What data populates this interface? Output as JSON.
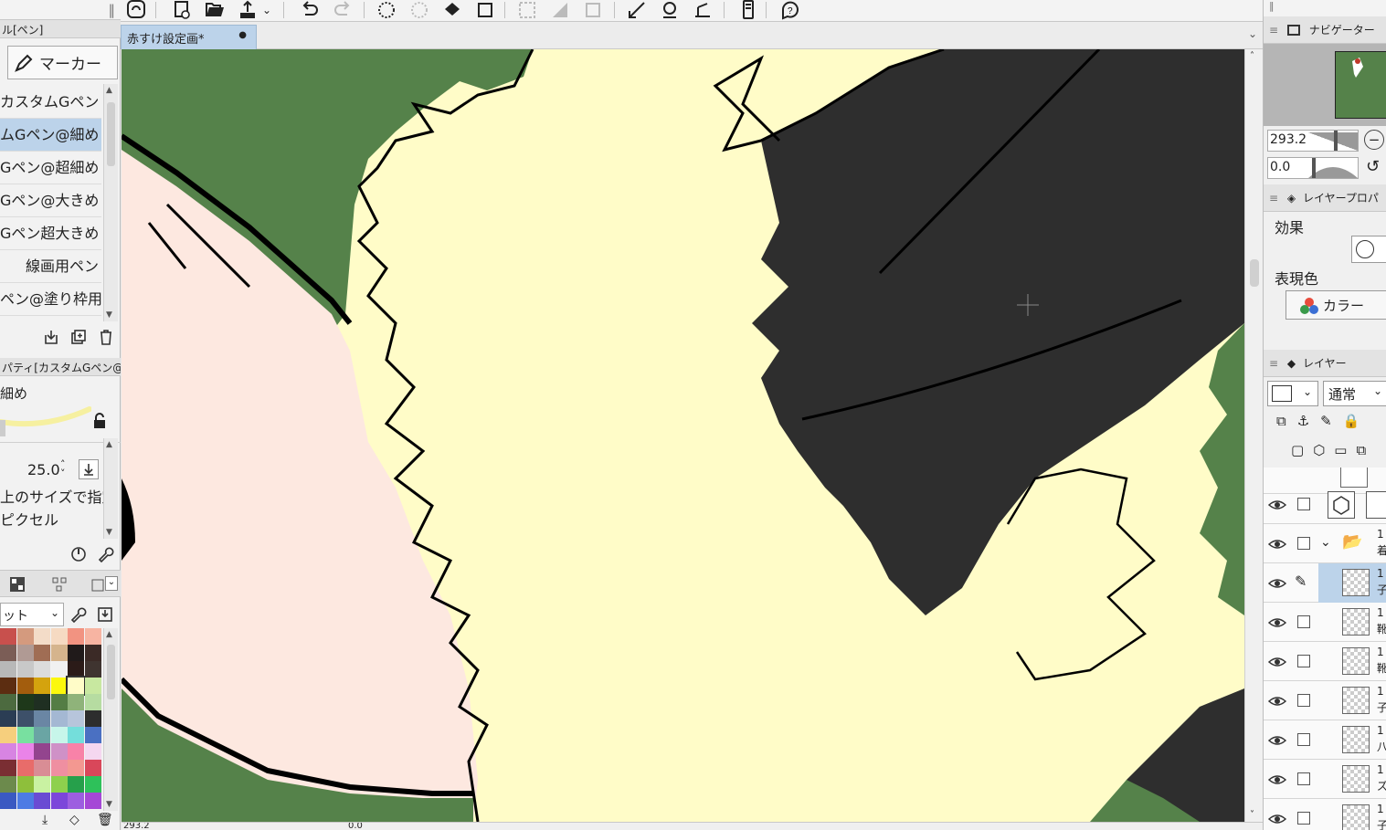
{
  "document_tab": {
    "title": "赤すけ設定画*",
    "modified_dot": "●"
  },
  "left_panel": {
    "panel_title": "ル[ペン]",
    "marker_tab_label": "マーカー",
    "brushes": [
      {
        "label": "カスタムGペン",
        "selected": false
      },
      {
        "label": "ムGペン@細め",
        "selected": true
      },
      {
        "label": "Gペン@超細め",
        "selected": false
      },
      {
        "label": "Gペン@大きめ",
        "selected": false
      },
      {
        "label": "Gペン超大きめ",
        "selected": false
      },
      {
        "label": "線画用ペン",
        "selected": false
      },
      {
        "label": "ペン@塗り枠用",
        "selected": false
      }
    ],
    "property_title": "パティ[カスタムGペン@",
    "property_brush_name": "細め",
    "brush_size_value": "25.0",
    "size_mode_line1": "上のサイズで指定",
    "size_mode_line2": "ピクセル",
    "palette_set_label": "ット"
  },
  "palette_colors": [
    [
      "#c8504d",
      "#d49a7e",
      "#f3dcc8",
      "#f6dac2",
      "#f29381",
      "#f7b4a2"
    ],
    [
      "#7b5d56",
      "#b09a94",
      "#a06d54",
      "#d5b48d",
      "#201a1a",
      "#3b2a26"
    ],
    [
      "#b8b8b8",
      "#c8c8c8",
      "#dcdcdc",
      "#f1f1f1",
      "#2b1b18",
      "#3f3430"
    ],
    [
      "#5c2d11",
      "#a35d0d",
      "#d4a30e",
      "#fcf80c",
      "#fffcc8",
      "#c8e8a0"
    ],
    [
      "#4c6a3f",
      "#1e381a",
      "#1f2f22",
      "#547d45",
      "#8fb37a",
      "#b6dca1"
    ],
    [
      "#2b3d54",
      "#3d5069",
      "#6a86a4",
      "#a4b8d3",
      "#b7c5db",
      "#2d2d2d"
    ],
    [
      "#f6cf7d",
      "#78e0a0",
      "#6aa5a4",
      "#c7f6ea",
      "#74dedb",
      "#4a70c2"
    ],
    [
      "#d784e2",
      "#ea83e8",
      "#93448e",
      "#cf91c7",
      "#f882a8",
      "#f5d7f0"
    ],
    [
      "#7a2e33",
      "#e86c6a",
      "#d98d95",
      "#ef8fa1",
      "#f39891",
      "#d9475a"
    ],
    [
      "#6c8a4c",
      "#8ebf3b",
      "#c9f2a2",
      "#8ed04d",
      "#26a04b",
      "#2ec15a"
    ],
    [
      "#3a59c2",
      "#4d7be4",
      "#6a4cd3",
      "#7c46da",
      "#9d5ee0",
      "#a548d6"
    ]
  ],
  "navigator": {
    "title": "ナビゲーター",
    "zoom_value": "293.2",
    "rotate_value": "0.0"
  },
  "layer_property": {
    "title": "レイヤープロパ",
    "effect_label": "効果",
    "expression_color_label": "表現色",
    "color_button_label": "カラー"
  },
  "layers_panel": {
    "title": "レイヤー",
    "blend_mode": "通常",
    "rows": [
      {
        "name": "1 着",
        "type": "folder",
        "selected": false
      },
      {
        "name": "1 子",
        "type": "raster",
        "selected": true
      },
      {
        "name": "1 靴",
        "type": "raster",
        "selected": false
      },
      {
        "name": "1 靴",
        "type": "raster",
        "selected": false
      },
      {
        "name": "1 子",
        "type": "raster",
        "selected": false
      },
      {
        "name": "1 八",
        "type": "raster",
        "selected": false
      },
      {
        "name": "1 ズ",
        "type": "raster",
        "selected": false
      },
      {
        "name": "1 子",
        "type": "raster",
        "selected": false
      }
    ]
  },
  "status_bar": {
    "zoom": "293.2",
    "angle": "0.0"
  },
  "colors": {
    "accent_selection": "#bcd3ea",
    "canvas_bg": "#fffcc8",
    "green": "#55824a",
    "skin": "#fde8e0",
    "dark_gray": "#2e2e2e"
  }
}
